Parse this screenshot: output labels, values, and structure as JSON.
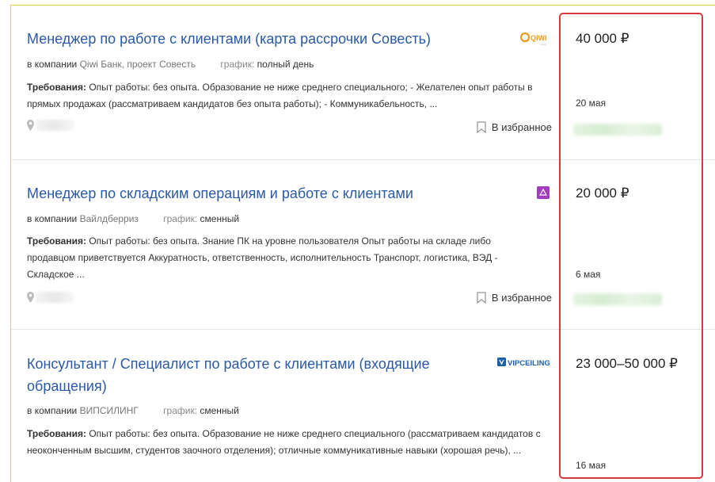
{
  "vacancies": [
    {
      "title": "Менеджер по работе с клиентами (карта рассрочки Совесть)",
      "company_prefix": "в компании",
      "company": "Qiwi Банк, проект Совесть",
      "schedule_label": "график:",
      "schedule": "полный день",
      "req_label": "Требования:",
      "requirements": "Опыт работы: без опыта. Образование не ниже среднего специального; - Желателен опыт работы в прямых продажах (рассматриваем кандидатов без опыта работы); - Коммуникабельность, ...",
      "favorite": "В избранное",
      "salary": "40 000 ₽",
      "date": "20 мая",
      "logo_text": "QIWI"
    },
    {
      "title": "Менеджер по складским операциям и работе с клиентами",
      "company_prefix": "в компании",
      "company": "Вайлдберриз",
      "schedule_label": "график:",
      "schedule": "сменный",
      "req_label": "Требования:",
      "requirements": "Опыт работы: без опыта. Знание ПК на уровне пользователя Опыт работы на складе либо продавцом приветствуется Аккуратность, ответственность, исполнительность Транспорт, логистика, ВЭД - Складское ...",
      "favorite": "В избранное",
      "salary": "20 000 ₽",
      "date": "6 мая",
      "logo_text": ""
    },
    {
      "title": "Консультант / Специалист по работе с клиентами (входящие обращения)",
      "company_prefix": "в компании",
      "company": "ВИПСИЛИНГ",
      "schedule_label": "график:",
      "schedule": "сменный",
      "req_label": "Требования:",
      "requirements": "Опыт работы: без опыта. Образование не ниже среднего специального (рассматриваем кандидатов с неоконченным высшим, студентов заочного отделения); отличные коммуникативные навыки (хорошая речь), ...",
      "favorite": "",
      "salary": "23 000–50 000 ₽",
      "date": "16 мая",
      "logo_text": "VIPCEILING"
    }
  ],
  "colors": {
    "link": "#2a5aa6",
    "highlight": "#d9383a",
    "frame": "#f0d23a",
    "wb_logo": "#a23bbd"
  }
}
